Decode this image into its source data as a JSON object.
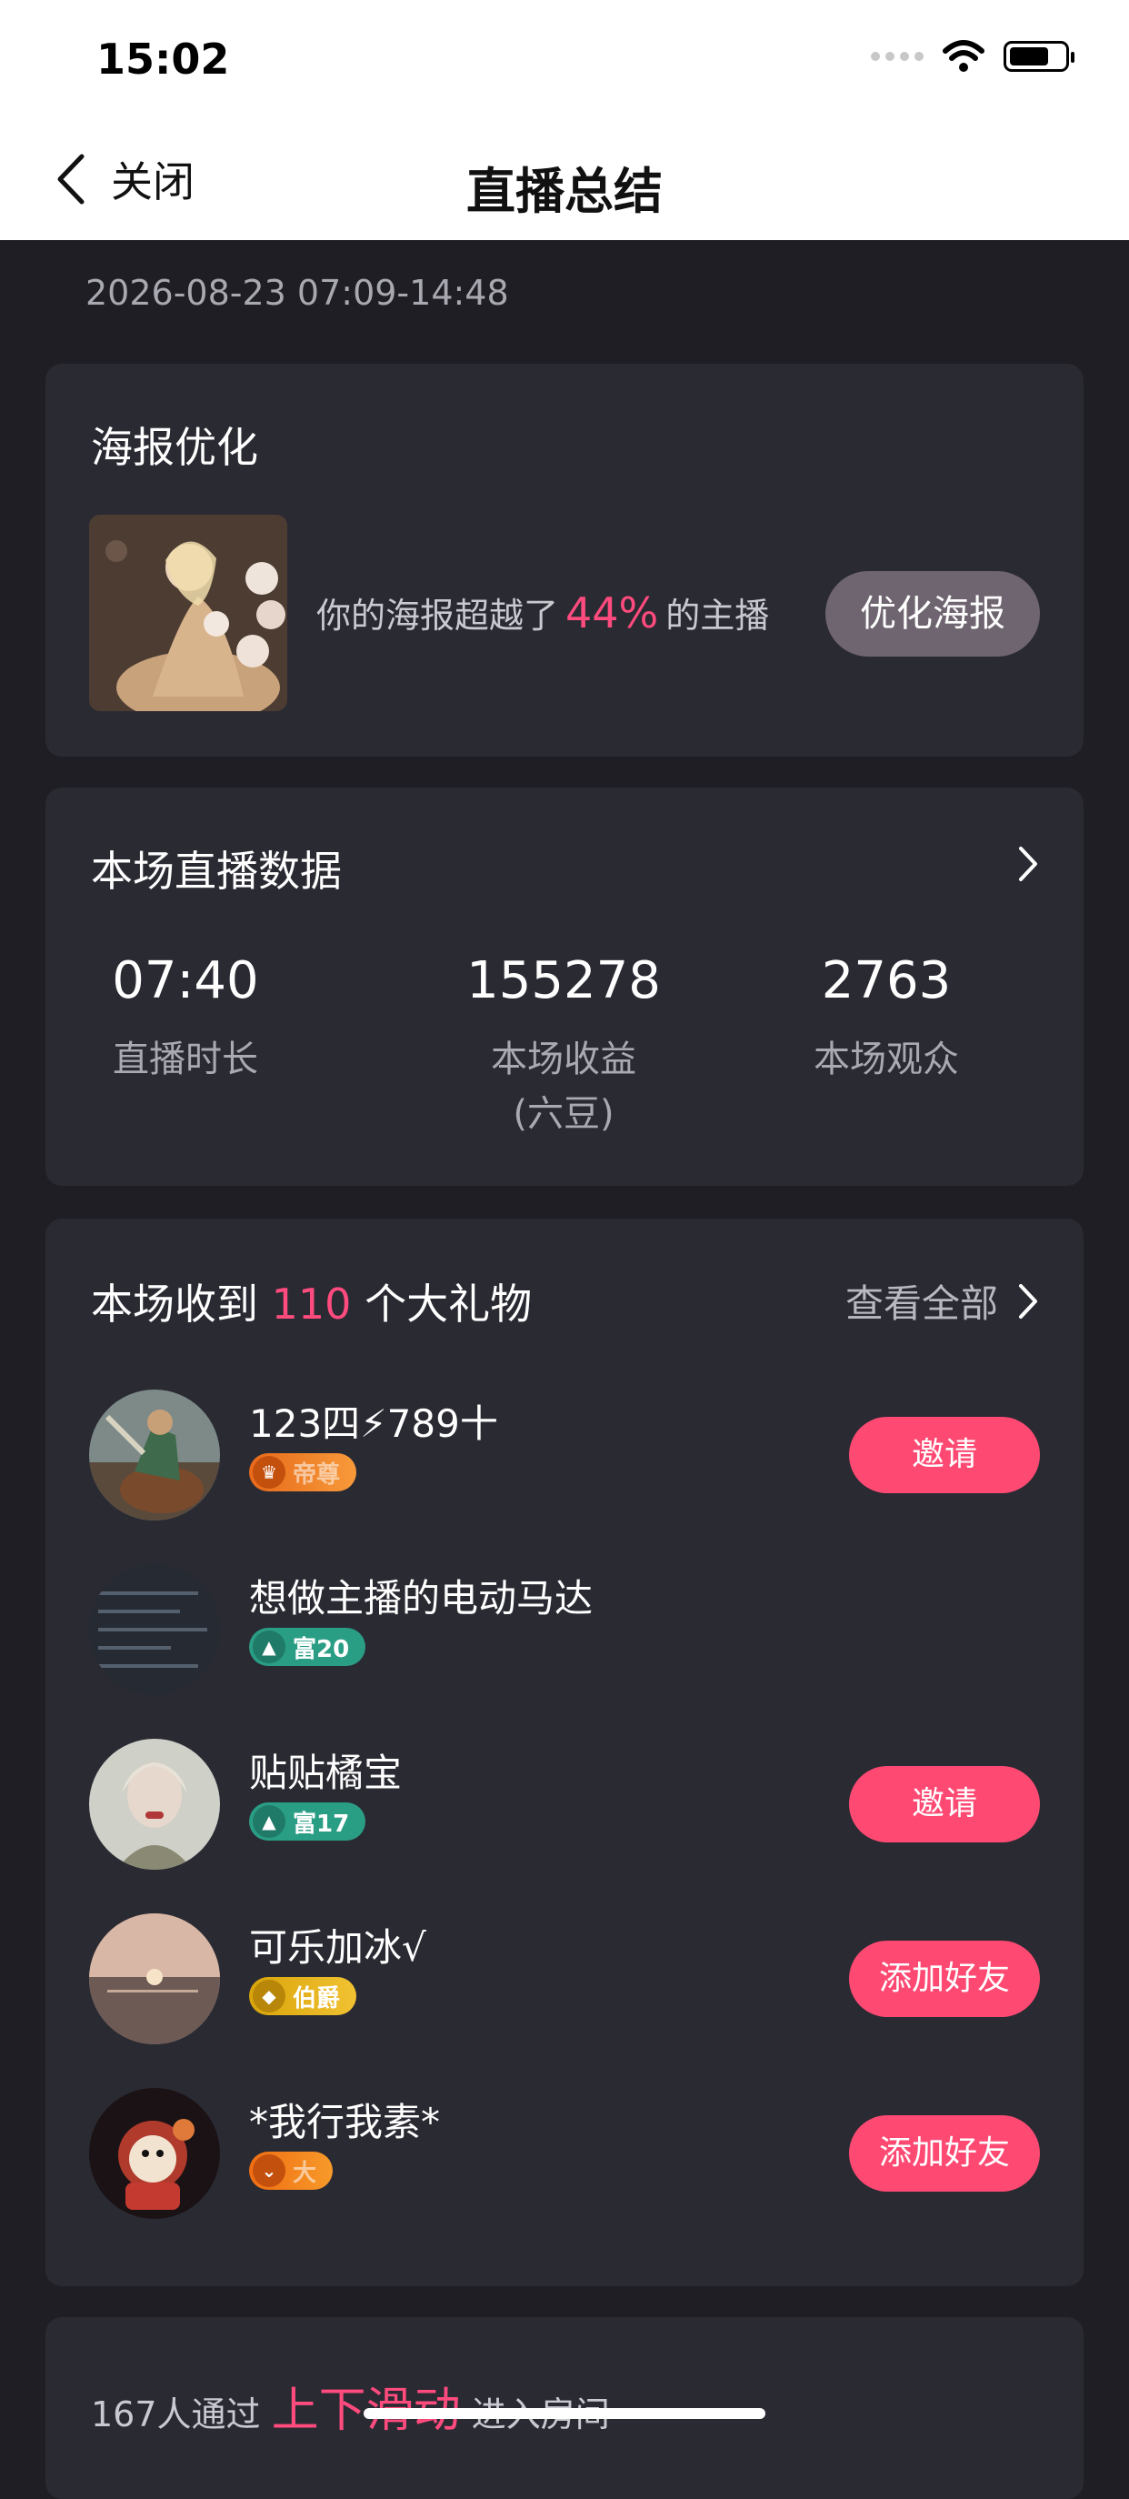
{
  "status_bar": {
    "time": "15:02"
  },
  "nav": {
    "back_label": "关闭",
    "title": "直播总结"
  },
  "time_range": "2026-08-23 07:09-14:48",
  "poster": {
    "title": "海报优化",
    "text_before": "你的海报超越了",
    "percent": "44%",
    "text_after": "的主播",
    "button": "优化海报"
  },
  "stats": {
    "title": "本场直播数据",
    "items": [
      {
        "value": "07:40",
        "label": "直播时长"
      },
      {
        "value": "155278",
        "label": "本场收益",
        "sub_label": "(六豆)"
      },
      {
        "value": "2763",
        "label": "本场观众"
      }
    ]
  },
  "gifts": {
    "title_before": "本场收到",
    "count": "110",
    "title_after": "个大礼物",
    "view_all": "查看全部",
    "rows": [
      {
        "name": "123四⚡789十",
        "badge": "帝尊",
        "action": "邀请"
      },
      {
        "name": "想做主播的电动马达",
        "badge": "富20",
        "action": ""
      },
      {
        "name": "贴贴橘宝",
        "badge": "富17",
        "action": "邀请"
      },
      {
        "name": "可乐加冰√",
        "badge": "伯爵",
        "action": "添加好友"
      },
      {
        "name": "*我行我素*",
        "badge": "大",
        "action": "添加好友"
      }
    ]
  },
  "slide": {
    "count_text": "167人通过",
    "highlight": "上下滑动",
    "after": "进入房间"
  },
  "colors": {
    "accent": "#fe4a73",
    "highlight": "#ff4b7d",
    "background": "#1f1e24",
    "card": "#2a2a33"
  }
}
